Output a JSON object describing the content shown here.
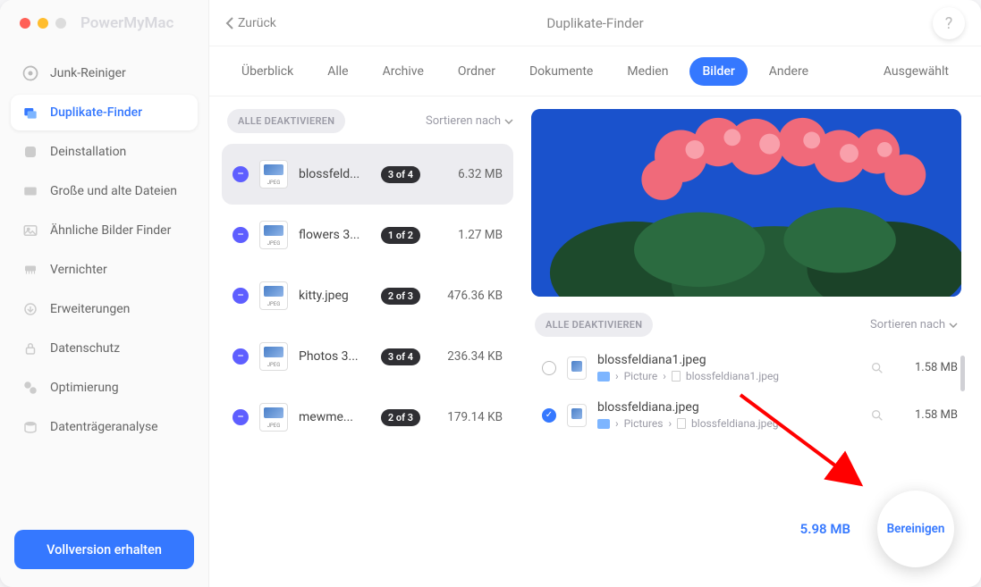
{
  "app_name": "PowerMyMac",
  "back_label": "Zurück",
  "page_title": "Duplikate-Finder",
  "help_label": "?",
  "sidebar": [
    {
      "label": "Junk-Reiniger"
    },
    {
      "label": "Duplikate-Finder"
    },
    {
      "label": "Deinstallation"
    },
    {
      "label": "Große und alte Dateien"
    },
    {
      "label": "Ähnliche Bilder Finder"
    },
    {
      "label": "Vernichter"
    },
    {
      "label": "Erweiterungen"
    },
    {
      "label": "Datenschutz"
    },
    {
      "label": "Optimierung"
    },
    {
      "label": "Datenträgeranalyse"
    }
  ],
  "vollversion_label": "Vollversion erhalten",
  "tabs": {
    "uberblick": "Überblick",
    "alle": "Alle",
    "archive": "Archive",
    "ordner": "Ordner",
    "dokumente": "Dokumente",
    "medien": "Medien",
    "bilder": "Bilder",
    "andere": "Andere",
    "ausgewaehlt": "Ausgewählt"
  },
  "alle_deaktivieren": "ALLE DEAKTIVIEREN",
  "sortieren_nach": "Sortieren nach",
  "thumb_ext": "JPEG",
  "groups": [
    {
      "name": "blossfeld...",
      "count": "3 of 4",
      "size": "6.32 MB"
    },
    {
      "name": "flowers 3...",
      "count": "1 of 2",
      "size": "1.27 MB"
    },
    {
      "name": "kitty.jpeg",
      "count": "2 of 3",
      "size": "476.36 KB"
    },
    {
      "name": "Photos 3...",
      "count": "3 of 4",
      "size": "236.34 KB"
    },
    {
      "name": "mewme...",
      "count": "2 of 3",
      "size": "179.14 KB"
    }
  ],
  "files": [
    {
      "name": "blossfeldiana1.jpeg",
      "folder": "Picture",
      "leaf": "blossfeldiana1.jpeg",
      "size": "1.58 MB",
      "selected": false
    },
    {
      "name": "blossfeldiana.jpeg",
      "folder": "Pictures",
      "leaf": "blossfeldiana.jpeg",
      "size": "1.58 MB",
      "selected": true
    }
  ],
  "total_size": "5.98 MB",
  "clean_label": "Bereinigen",
  "path_sep": "›"
}
